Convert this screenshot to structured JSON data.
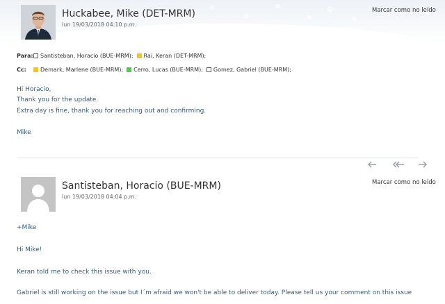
{
  "message1": {
    "sender": "Huckabee, Mike (DET-MRM)",
    "datetime": "lun 19/03/2018 04:10 p.m.",
    "mark_unread": "Marcar como no leído",
    "to_label": "Para:",
    "to": [
      {
        "name": "Santisteban, Horacio (BUE-MRM);",
        "color": "none"
      },
      {
        "name": "Rai, Keran (DET-MRM);",
        "color": "#f2c61b"
      }
    ],
    "cc_label": "Cc:",
    "cc": [
      {
        "name": "Demark, Marlene (BUE-MRM);",
        "color": "#f2c61b"
      },
      {
        "name": "Cerro, Lucas (BUE-MRM);",
        "color": "#5cc35c"
      },
      {
        "name": "Gomez, Gabriel (BUE-MRM);",
        "color": "none"
      }
    ],
    "body": [
      "Hi Horacio,",
      "Thank you for the update.",
      "Extra day is fine, thank you for reaching out and confirming.",
      "Mike"
    ]
  },
  "nav": {
    "reply_icon": "reply-icon",
    "reply_all_icon": "reply-all-icon",
    "forward_icon": "forward-icon"
  },
  "message2": {
    "sender": "Santisteban, Horacio (BUE-MRM)",
    "datetime": "lun 19/03/2018 04:04 p.m.",
    "mark_unread": "Marcar como no leído",
    "body": [
      "+Mike",
      "Hi Mike!",
      "Keran told me to check this issue with you.",
      "Gabriel is still working on the issue but I´m afraid we won't be able to deliver today. Please tell us your comment on this issue"
    ]
  },
  "colors": {
    "body_text": "#2d5c8a",
    "yellow_category": "#f2c61b",
    "green_category": "#5cc35c"
  }
}
